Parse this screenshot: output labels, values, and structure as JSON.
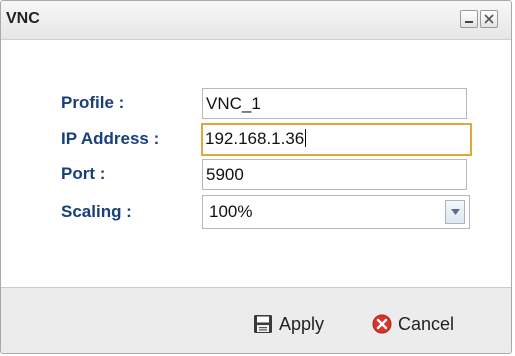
{
  "window": {
    "title": "VNC"
  },
  "form": {
    "profile": {
      "label": "Profile :",
      "value": "VNC_1"
    },
    "ip_address": {
      "label": "IP Address :",
      "value": "192.168.1.36"
    },
    "port": {
      "label": "Port :",
      "value": "5900"
    },
    "scaling": {
      "label": "Scaling :",
      "value": "100%"
    }
  },
  "footer": {
    "apply_label": "Apply",
    "cancel_label": "Cancel"
  },
  "icons": {
    "minimize": "minimize-icon",
    "close": "close-icon",
    "apply": "save-disk-icon",
    "cancel": "red-x-circle-icon",
    "dropdown": "chevron-down-icon"
  },
  "colors": {
    "label_text": "#1a3f7a",
    "focus_border": "#e0a83a",
    "cancel_icon": "#d9342b"
  }
}
